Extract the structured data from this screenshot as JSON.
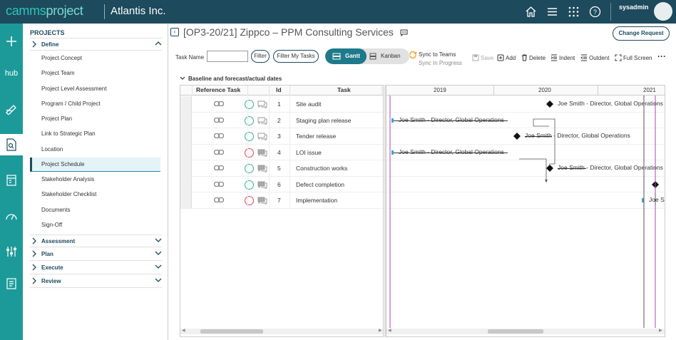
{
  "app": {
    "logo_part1": "camms",
    "logo_part2": "project",
    "org": "Atlantis Inc.",
    "username": "sysadmin"
  },
  "nav": {
    "title": "PROJECTS",
    "define": "Define",
    "items": [
      "Project Concept",
      "Project Team",
      "Project Level Assessment",
      "Program / Child Project",
      "Project Plan",
      "Link to Strategic Plan",
      "Location",
      "Project Schedule",
      "Stakeholder Analysis",
      "Stakeholder Checklist",
      "Documents",
      "Sign-Off"
    ],
    "groups": [
      "Assessment",
      "Plan",
      "Execute",
      "Review"
    ],
    "active_item": "Project Schedule"
  },
  "header": {
    "title": "[OP3-20/21] Zippco – PPM Consulting Services",
    "change_request": "Change Request"
  },
  "toolbar": {
    "task_name_label": "Task Name",
    "task_name_value": "",
    "filter": "Filter",
    "filter_my_tasks": "Filter My Tasks",
    "gantt": "Gantt",
    "kanban": "Kanban",
    "sync_title": "Sync to Teams",
    "sync_sub": "Sync In Progress",
    "save": "Save",
    "add": "Add",
    "delete": "Delete",
    "indent": "Indent",
    "outdent": "Outdent",
    "fullscreen": "Full Screen"
  },
  "section": {
    "label": "Baseline and forecast/actual dates"
  },
  "grid": {
    "columns": [
      "Reference Task",
      "Id",
      "Task"
    ],
    "rows": [
      {
        "id": "1",
        "task": "Site audit",
        "status": "green"
      },
      {
        "id": "2",
        "task": "Staging plan release",
        "status": "green"
      },
      {
        "id": "3",
        "task": "Tender release",
        "status": "green"
      },
      {
        "id": "4",
        "task": "LOI issue",
        "status": "red"
      },
      {
        "id": "5",
        "task": "Construction works",
        "status": "green"
      },
      {
        "id": "6",
        "task": "Defect completion",
        "status": "green"
      },
      {
        "id": "7",
        "task": "Implementation",
        "status": "red"
      }
    ]
  },
  "gantt": {
    "years": [
      "2019",
      "2020",
      "2021"
    ],
    "labels": [
      "Joe Smith - Director, Global Operations",
      "Joe Smith - Director, Global Operations",
      "Joe Smith - Director, Global Operations",
      "Joe Smith - Director, Global Operations",
      "Joe Smith - Director, Global Operations",
      "",
      "Joe Sm"
    ]
  },
  "colors": {
    "topbar": "#1d4a5c",
    "rail": "#1c9a9a",
    "accent": "#1d7a8a",
    "green": "#2fb38a",
    "red": "#d9495b"
  }
}
